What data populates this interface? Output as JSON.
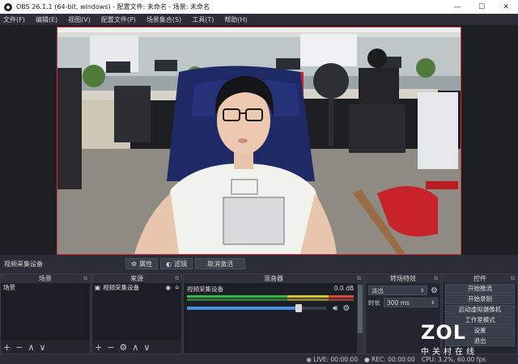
{
  "window": {
    "title": "OBS 26.1.1 (64-bit, windows) - 配置文件: 未命名 - 场景: 未命名",
    "minimize": "—",
    "maximize": "☐",
    "close": "✕"
  },
  "menubar": [
    "文件(F)",
    "编辑(E)",
    "视图(V)",
    "配置文件(P)",
    "场景集合(S)",
    "工具(T)",
    "帮助(H)"
  ],
  "source_toolbar": {
    "source_name": "视频采集设备",
    "properties": "属性",
    "filters": "滤镜",
    "deactivate": "取消激活"
  },
  "scenes": {
    "title": "场景",
    "items": [
      "场景"
    ],
    "tools": [
      "+",
      "−",
      "∧",
      "∨"
    ]
  },
  "sources": {
    "title": "来源",
    "items": [
      "视频采集设备"
    ],
    "tools": [
      "+",
      "−",
      "⚙",
      "∧",
      "∨"
    ]
  },
  "mixer": {
    "title": "混音器",
    "channel_name": "视频采集设备",
    "level": "0.0 dB",
    "volume_fraction": 0.8
  },
  "transitions": {
    "title": "转场特效",
    "type": "淡出",
    "duration_label": "时长",
    "duration_value": "300 ms"
  },
  "controls": {
    "title": "控件",
    "buttons": [
      "开始推流",
      "开始录制",
      "启动虚拟摄像机",
      "工作室模式",
      "设置",
      "退出"
    ]
  },
  "statusbar": {
    "live": "LIVE: 00:00:00",
    "rec": "REC: 00:00:00",
    "cpu": "CPU: 3.2%, 60.00 fps"
  },
  "watermark": {
    "logo": "ZOL",
    "subtitle": "中关村在线"
  },
  "colors": {
    "accent_red": "#d9333a",
    "panel_bg": "#2b2e38",
    "dock_bg": "#232530",
    "meter_green": "#3bb54a",
    "meter_yellow": "#d4c33a",
    "meter_red": "#d84a3a",
    "volume_blue": "#4a8ee0"
  }
}
